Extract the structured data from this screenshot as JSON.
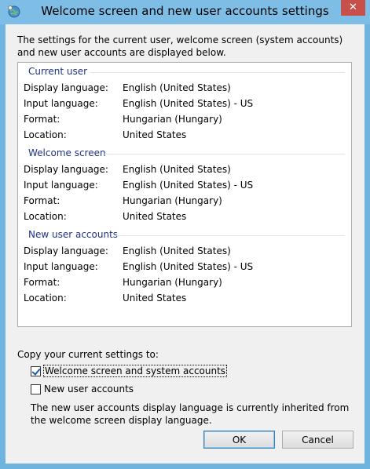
{
  "window": {
    "title": "Welcome screen and new user accounts settings",
    "close_glyph": "✕"
  },
  "intro": "The settings for the current user, welcome screen (system accounts) and new user accounts are displayed below.",
  "groups": [
    {
      "header": "Current user",
      "rows": [
        {
          "label": "Display language:",
          "value": "English (United States)"
        },
        {
          "label": "Input language:",
          "value": "English (United States) - US"
        },
        {
          "label": "Format:",
          "value": "Hungarian (Hungary)"
        },
        {
          "label": "Location:",
          "value": "United States"
        }
      ]
    },
    {
      "header": "Welcome screen",
      "rows": [
        {
          "label": "Display language:",
          "value": "English (United States)"
        },
        {
          "label": "Input language:",
          "value": "English (United States) - US"
        },
        {
          "label": "Format:",
          "value": "Hungarian (Hungary)"
        },
        {
          "label": "Location:",
          "value": "United States"
        }
      ]
    },
    {
      "header": "New user accounts",
      "rows": [
        {
          "label": "Display language:",
          "value": "English (United States)"
        },
        {
          "label": "Input language:",
          "value": "English (United States) - US"
        },
        {
          "label": "Format:",
          "value": "Hungarian (Hungary)"
        },
        {
          "label": "Location:",
          "value": "United States"
        }
      ]
    }
  ],
  "copy": {
    "label": "Copy your current settings to:",
    "options": [
      {
        "label": "Welcome screen and system accounts",
        "checked": true
      },
      {
        "label": "New user accounts",
        "checked": false
      }
    ],
    "note": "The new user accounts display language is currently inherited from the welcome screen display language."
  },
  "buttons": {
    "ok": "OK",
    "cancel": "Cancel"
  }
}
